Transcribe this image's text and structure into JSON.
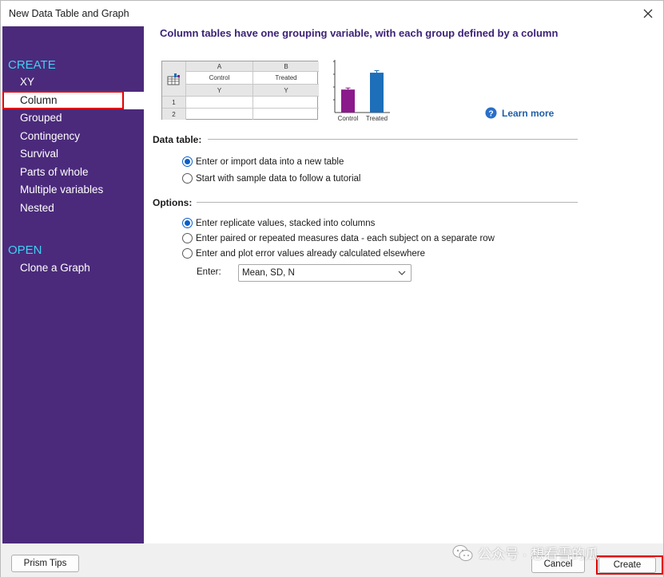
{
  "window": {
    "title": "New Data Table and Graph"
  },
  "sidebar": {
    "create_heading": "CREATE",
    "create_items": [
      "XY",
      "Column",
      "Grouped",
      "Contingency",
      "Survival",
      "Parts of whole",
      "Multiple variables",
      "Nested"
    ],
    "selected_item": "Column",
    "open_heading": "OPEN",
    "open_items": [
      "Clone a Graph"
    ]
  },
  "description": {
    "title": "Column tables have one grouping variable, with each group defined by a column"
  },
  "preview_table": {
    "columns": [
      {
        "letter": "A",
        "name": "Control",
        "sub": "Y"
      },
      {
        "letter": "B",
        "name": "Treated",
        "sub": "Y"
      }
    ],
    "rows": [
      "1",
      "2"
    ]
  },
  "chart_data": {
    "type": "bar",
    "categories": [
      "Control",
      "Treated"
    ],
    "values": [
      45,
      78
    ],
    "errors": [
      3,
      4
    ],
    "colors": [
      "#8b1a8b",
      "#1c6fb8"
    ],
    "ylim": [
      0,
      100
    ]
  },
  "learn_more": {
    "label": "Learn more",
    "icon": "help-icon"
  },
  "data_table": {
    "label": "Data table:",
    "options": [
      {
        "label": "Enter or import data into a new table",
        "checked": true
      },
      {
        "label": "Start with sample data to follow a tutorial",
        "checked": false
      }
    ]
  },
  "options": {
    "label": "Options:",
    "items": [
      {
        "label": "Enter replicate values, stacked into columns",
        "checked": true
      },
      {
        "label": "Enter paired or repeated measures data - each subject on a separate row",
        "checked": false
      },
      {
        "label": "Enter and plot error values already calculated elsewhere",
        "checked": false
      }
    ],
    "enter_label": "Enter:",
    "enter_value": "Mean, SD, N"
  },
  "footer": {
    "prism_tips": "Prism Tips",
    "cancel": "Cancel",
    "create": "Create"
  },
  "watermark": "公众号 · 想看雪的瓜",
  "colors": {
    "sidebar_bg": "#4b2a7b",
    "sidebar_heading": "#3fd0f4",
    "title_purple": "#3c2277",
    "radio_blue": "#0a5fc7",
    "highlight_red": "#e00000"
  }
}
